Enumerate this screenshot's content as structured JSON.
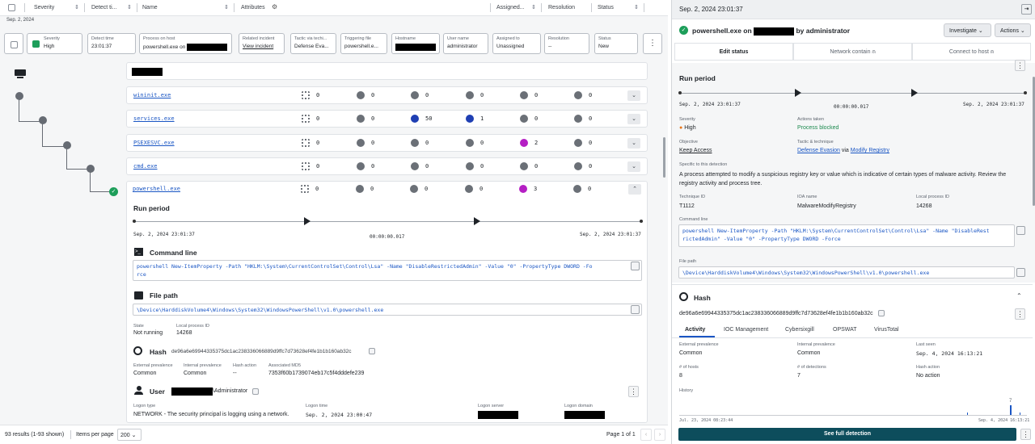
{
  "columns": {
    "severity": "Severity",
    "detect_time": "Detect ti...",
    "name": "Name",
    "attributes": "Attributes",
    "assigned": "Assigned...",
    "resolution": "Resolution",
    "status": "Status"
  },
  "date_group": "Sep. 2, 2024",
  "summary": {
    "severity_label": "Severity",
    "severity_value": "High",
    "detect_label": "Detect time",
    "detect_value": "23:01:37",
    "process_label": "Process on host",
    "process_value": "powershell.exe on",
    "incident_label": "Related incident",
    "incident_value": "View incident",
    "tactic_label": "Tactic via techi...",
    "tactic_value": "Defense Eva...",
    "file_label": "Triggering file",
    "file_value": "powershell.e...",
    "hostname_label": "Hostname",
    "user_label": "User name",
    "user_value": "administrator",
    "assigned_label": "Assigned to",
    "assigned_value": "Unassigned",
    "resolution_label": "Resolution",
    "resolution_value": "--",
    "status_label": "Status",
    "status_value": "New"
  },
  "processes": [
    {
      "name": "wininit.exe",
      "s1": "0",
      "s2": "0",
      "s3": "0",
      "s4": "0",
      "s5": "0",
      "s6": "0"
    },
    {
      "name": "services.exe",
      "s1": "0",
      "s2": "0",
      "s3": "50",
      "s4": "1",
      "s5": "0",
      "s6": "0"
    },
    {
      "name": "PSEXESVC.exe",
      "s1": "0",
      "s2": "0",
      "s3": "0",
      "s4": "0",
      "s5": "2",
      "s6": "0"
    },
    {
      "name": "cmd.exe",
      "s1": "0",
      "s2": "0",
      "s3": "0",
      "s4": "0",
      "s5": "0",
      "s6": "0"
    },
    {
      "name": "powershell.exe",
      "s1": "0",
      "s2": "0",
      "s3": "0",
      "s4": "0",
      "s5": "3",
      "s6": "0"
    }
  ],
  "detail": {
    "run_period": "Run period",
    "start": "Sep. 2, 2024 23:01:37",
    "duration": "00:00:00.017",
    "end": "Sep. 2, 2024 23:01:37",
    "cmd_title": "Command line",
    "cmd": "powershell New-ItemProperty -Path \"HKLM:\\System\\CurrentControlSet\\Control\\Lsa\" -Name \"DisableRestrictedAdmin\" -Value \"0\" -PropertyType DWORD -Force",
    "cmd_line1": "powershell New-ItemProperty -Path \"HKLM:\\System\\CurrentControlSet\\Control\\Lsa\" -Name \"DisableRestrictedAdmin\" -Value \"0\" -PropertyType DWORD -Fo",
    "cmd_line2": "rce",
    "filepath_title": "File path",
    "filepath": "\\Device\\HarddiskVolume4\\Windows\\System32\\WindowsPowerShell\\v1.0\\powershell.exe",
    "state_label": "State",
    "state_value": "Not running",
    "pid_label": "Local process ID",
    "pid_value": "14268",
    "hash_title": "Hash",
    "hash": "de96a6e69944335375dc1ac238336066889d9ffc7d73628ef4fe1b1b160ab32c",
    "ext_prev_label": "External prevalence",
    "ext_prev_value": "Common",
    "int_prev_label": "Internal prevalence",
    "int_prev_value": "Common",
    "hash_action_label": "Hash action",
    "hash_action_value": "--",
    "md5_label": "Associated MD5",
    "md5_value": "7353f60b1739074eb17c5f4dddefe239",
    "user_title": "User",
    "user_suffix": "\\Administrator",
    "logon_type_label": "Logon type",
    "logon_type_value": "NETWORK - The security principal is logging using a network.",
    "logon_time_label": "Logon time",
    "logon_time_value": "Sep. 2, 2024 23:00:47",
    "logon_server_label": "Logon server",
    "logon_domain_label": "Logon domain"
  },
  "footer": {
    "results": "93 results (1-93 shown)",
    "items_per_page_label": "Items per page",
    "items_per_page": "200",
    "page": "Page 1 of 1"
  },
  "panel": {
    "title": "Sep. 2, 2024 23:01:37",
    "heading_pre": "powershell.exe on",
    "heading_post": "by administrator",
    "investigate": "Investigate",
    "actions": "Actions",
    "tabs": [
      "Edit status",
      "Network contain",
      "Connect to host"
    ],
    "run_period": "Run period",
    "start": "Sep. 2, 2024 23:01:37",
    "duration": "00:00:00.017",
    "end": "Sep. 2, 2024 23:01:37",
    "severity_label": "Severity",
    "severity_value": "High",
    "actions_label": "Actions taken",
    "actions_value": "Process blocked",
    "objective_label": "Objective",
    "objective_value": "Keep Access",
    "tactic_label": "Tactic & technique",
    "tactic_value": "Defense Evasion",
    "tactic_via": "via",
    "technique_value": "Modify Registry",
    "specific_label": "Specific to this detection",
    "specific_value": "A process attempted to modify a suspicious registry key or value which is indicative of certain types of malware activity. Review the registry activity and process tree.",
    "technique_id_label": "Technique ID",
    "technique_id_value": "T1112",
    "ioa_label": "IOA name",
    "ioa_value": "MalwareModifyRegistry",
    "pid_label": "Local process ID",
    "pid_value": "14268",
    "cmd_label": "Command line",
    "cmd_line1": "powershell New-ItemProperty -Path \"HKLM:\\System\\CurrentControlSet\\Control\\Lsa\" -Name \"DisableRest",
    "cmd_line2": "rictedAdmin\" -Value \"0\" -PropertyType DWORD -Force",
    "filepath_label": "File path",
    "filepath": "\\Device\\HarddiskVolume4\\Windows\\System32\\WindowsPowerShell\\v1.0\\powershell.exe",
    "hash_title": "Hash",
    "hash": "de96a6e69944335375dc1ac238336066889d9ffc7d73628ef4fe1b1b160ab32c",
    "hash_tabs": [
      "Activity",
      "IOC Management",
      "Cybersixgill",
      "OPSWAT",
      "VirusTotal"
    ],
    "ext_prev_label": "External prevalence",
    "ext_prev_value": "Common",
    "int_prev_label": "Internal prevalence",
    "int_prev_value": "Common",
    "last_seen_label": "Last seen",
    "last_seen_value": "Sep. 4, 2024 16:13:21",
    "hosts_label": "# of hosts",
    "hosts_value": "8",
    "detections_label": "# of detections",
    "detections_value": "7",
    "hash_action_label": "Hash action",
    "hash_action_value": "No action",
    "history_label": "History",
    "history_start": "Jul. 23, 2024 08:23:44",
    "history_end": "Sep. 4, 2024 16:13:21",
    "history_peak": "7",
    "see_full": "See full detection"
  }
}
